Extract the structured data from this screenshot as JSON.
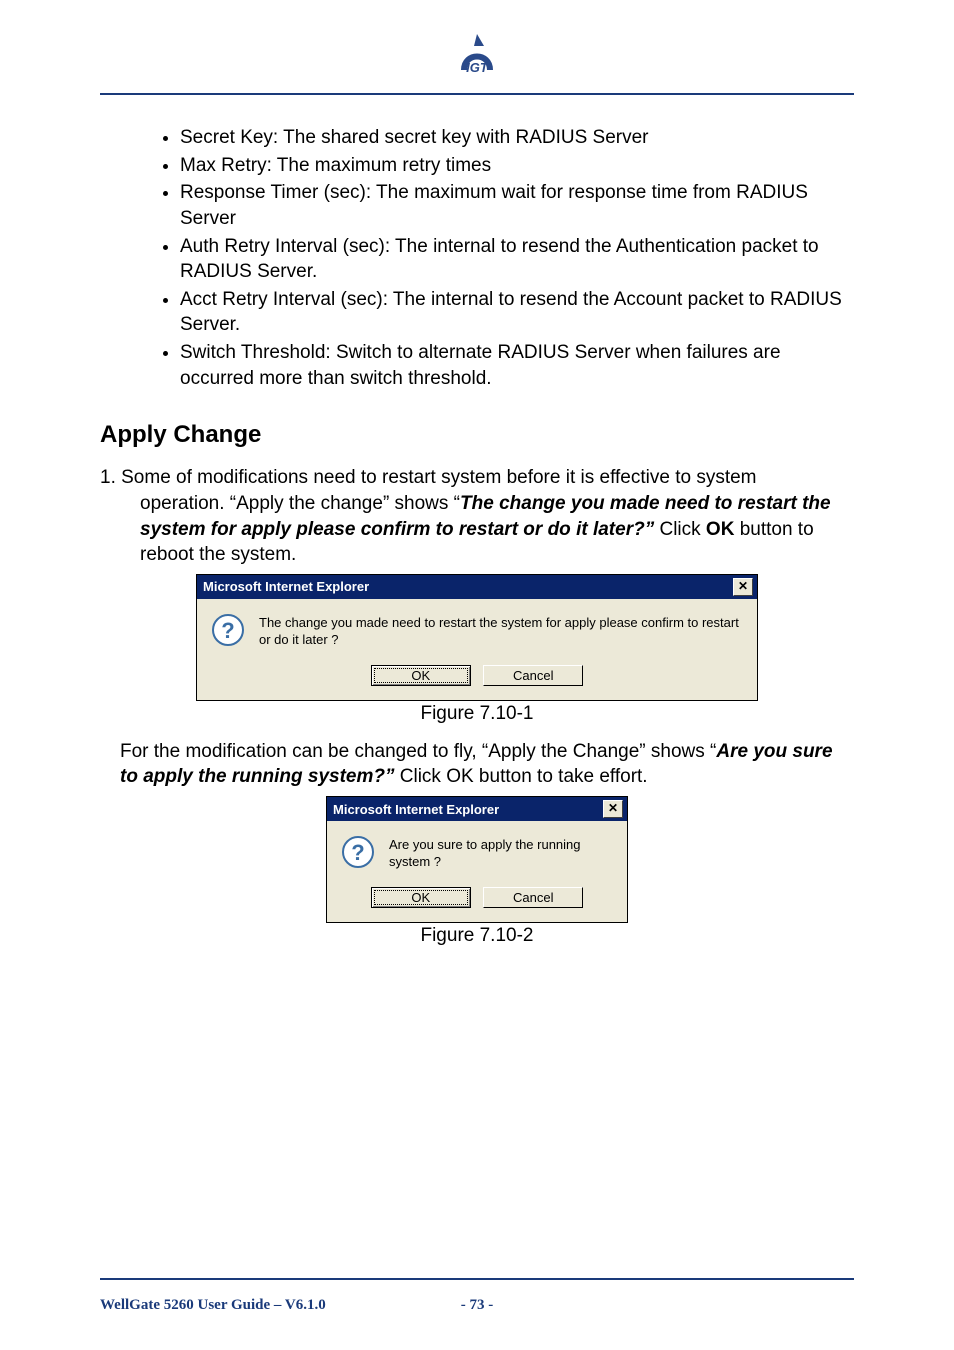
{
  "bullets": [
    "Secret Key: The shared secret key with RADIUS Server",
    "Max Retry: The maximum retry times",
    "Response Timer (sec): The maximum wait for response time from RADIUS Server",
    "Auth Retry Interval (sec): The internal to resend the Authentication packet to RADIUS Server.",
    "Acct Retry Interval (sec): The internal to resend the Account packet to RADIUS Server.",
    "Switch Threshold: Switch to alternate RADIUS Server when failures are occurred more than switch threshold."
  ],
  "heading": "Apply Change",
  "para1": {
    "lead": "1. Some of modifications need to restart system before it is effective to system",
    "cont1": "operation. “Apply the change” shows “",
    "bold1": "The change you made need to restart the system for apply please confirm to restart or do it later?”",
    "cont2": " Click ",
    "bold2": "OK",
    "cont3": " button to reboot the system."
  },
  "dialog1": {
    "title": "Microsoft Internet Explorer",
    "close": "✕",
    "message": "The change you made need to restart the system for apply please confirm to restart or do it later ?",
    "ok": "OK",
    "cancel": "Cancel"
  },
  "figure1": "Figure 7.10-1",
  "para2": {
    "lead": "For the modification can be changed to fly, “Apply the Change” shows “",
    "bold1": "Are you sure to apply the running system?”",
    "tail": " Click OK button to take effort."
  },
  "dialog2": {
    "title": "Microsoft Internet Explorer",
    "close": "✕",
    "message": "Are you sure to apply the running system ?",
    "ok": "OK",
    "cancel": "Cancel"
  },
  "figure2": "Figure 7.10-2",
  "footer": {
    "left": "WellGate 5260 User Guide – V6.1.0",
    "page": "- 73 -"
  }
}
